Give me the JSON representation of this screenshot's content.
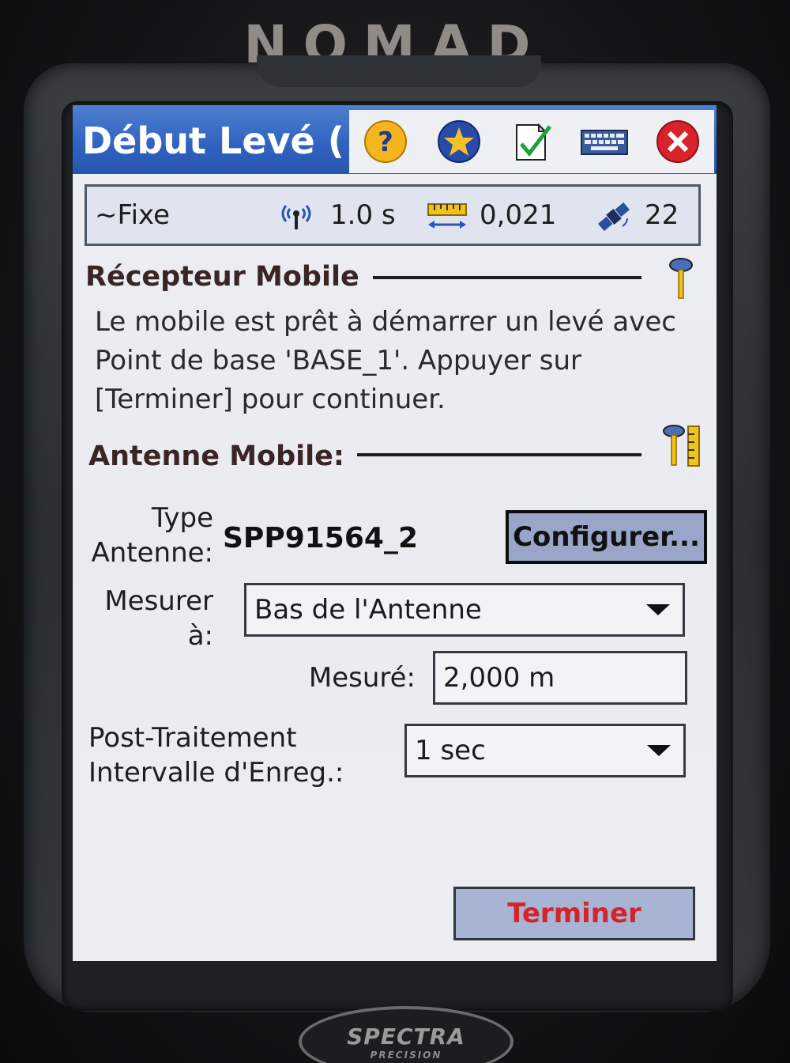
{
  "device": {
    "brand": "NOMAD",
    "logo_main": "SPECTRA",
    "logo_sub": "PRECISION"
  },
  "titlebar": {
    "title": "Début Levé (",
    "icons": [
      "help-icon",
      "favorite-star-icon",
      "checklist-icon",
      "keyboard-icon",
      "close-icon"
    ]
  },
  "status": {
    "solution": "~Fixe",
    "interval": "1.0 s",
    "precision": "0,021",
    "satellites": "22"
  },
  "receiver": {
    "heading": "Récepteur Mobile",
    "message": "Le mobile est prêt à démarrer un levé avec Point de base 'BASE_1'. Appuyer sur [Terminer] pour continuer."
  },
  "antenna": {
    "heading": "Antenne Mobile:",
    "type_label_line1": "Type",
    "type_label_line2": "Antenne:",
    "type_value": "SPP91564_2",
    "configure_label": "Configurer...",
    "measure_to_label_line1": "Mesurer",
    "measure_to_label_line2": "à:",
    "measure_to_value": "Bas de l'Antenne",
    "measured_label": "Mesuré:",
    "measured_value": "2,000 m",
    "post_label_line1": "Post-Traitement",
    "post_label_line2": "Intervalle d'Enreg.:",
    "post_value": "1 sec"
  },
  "footer": {
    "finish_label": "Terminer"
  },
  "colors": {
    "titlebar": "#2f62bf",
    "finish_text": "#d3242a",
    "screen_bg": "#eceef3"
  }
}
